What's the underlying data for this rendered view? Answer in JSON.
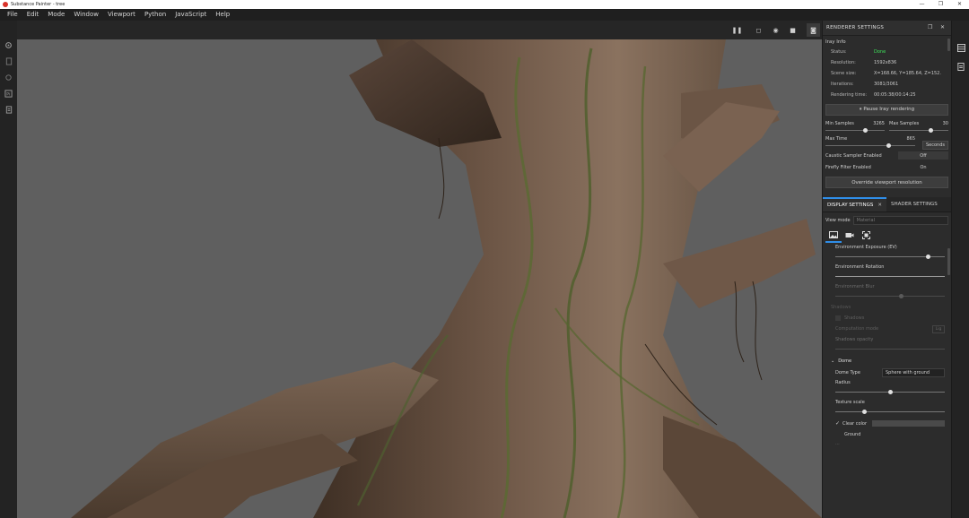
{
  "window": {
    "title": "Substance Painter - tree",
    "controls": [
      "—",
      "❐",
      "✕"
    ]
  },
  "menubar": [
    "File",
    "Edit",
    "Mode",
    "Window",
    "Viewport",
    "Python",
    "JavaScript",
    "Help"
  ],
  "left_toolbar": [
    "gear-icon",
    "layers-icon",
    "settings-icon",
    "python-icon",
    "document-icon"
  ],
  "viewport_toolbar": {
    "pause": "❚❚",
    "frame": "◻",
    "environment": "◉",
    "camera": "■",
    "render": "◙"
  },
  "renderer_settings": {
    "title": "RENDERER SETTINGS",
    "section": "Iray Info",
    "info": [
      {
        "key": "Status:",
        "value": "Done",
        "status": "ok"
      },
      {
        "key": "Resolution:",
        "value": "1592x836"
      },
      {
        "key": "Scene size:",
        "value": "X=168.66, Y=185.64, Z=152."
      },
      {
        "key": "Iterations:",
        "value": "3081/3061"
      },
      {
        "key": "Rendering time:",
        "value": "00:05:38/00:14:25"
      }
    ],
    "pause_button": "⏸ Pause Iray rendering",
    "min_samples_label": "Min Samples",
    "min_samples_value": "3265",
    "min_samples_level": 0.68,
    "max_samples_label": "Max Samples",
    "max_samples_value": "30",
    "max_samples_level": 0.7,
    "max_time_label": "Max Time",
    "max_time_value": "865",
    "max_time_level": 0.7,
    "time_unit": "Seconds",
    "caustic_label": "Caustic Sampler Enabled",
    "caustic_value": "Off",
    "firefly_label": "Firefly Filter Enabled",
    "firefly_value": "On",
    "override_button": "Override viewport resolution"
  },
  "display_settings": {
    "tab_display": "DISPLAY SETTINGS",
    "tab_shader": "SHADER SETTINGS",
    "view_mode_label": "View mode",
    "view_mode_value": "Material",
    "env_exposure_label": "Environment Exposure (EV)",
    "env_exposure_level": 0.85,
    "env_rotation_label": "Environment Rotation",
    "env_blur_label": "Environment Blur",
    "env_blur_level": 0.6,
    "shadows_group": "Shadows",
    "shadows_check": "Shadows",
    "computation_label": "Computation mode",
    "computation_value": "Lig",
    "shadows_opacity_label": "Shadows opacity",
    "dome_header": "Dome",
    "dome_type_label": "Dome Type",
    "dome_type_value": "Sphere with ground",
    "radius_label": "Radius",
    "radius_level": 0.5,
    "texture_scale_label": "Texture scale",
    "texture_scale_level": 0.27,
    "clear_color_label": "Clear color",
    "ground_label": "Ground",
    "bottom_label": "..."
  },
  "right_dock": [
    "layers-panel-icon",
    "properties-panel-icon"
  ]
}
